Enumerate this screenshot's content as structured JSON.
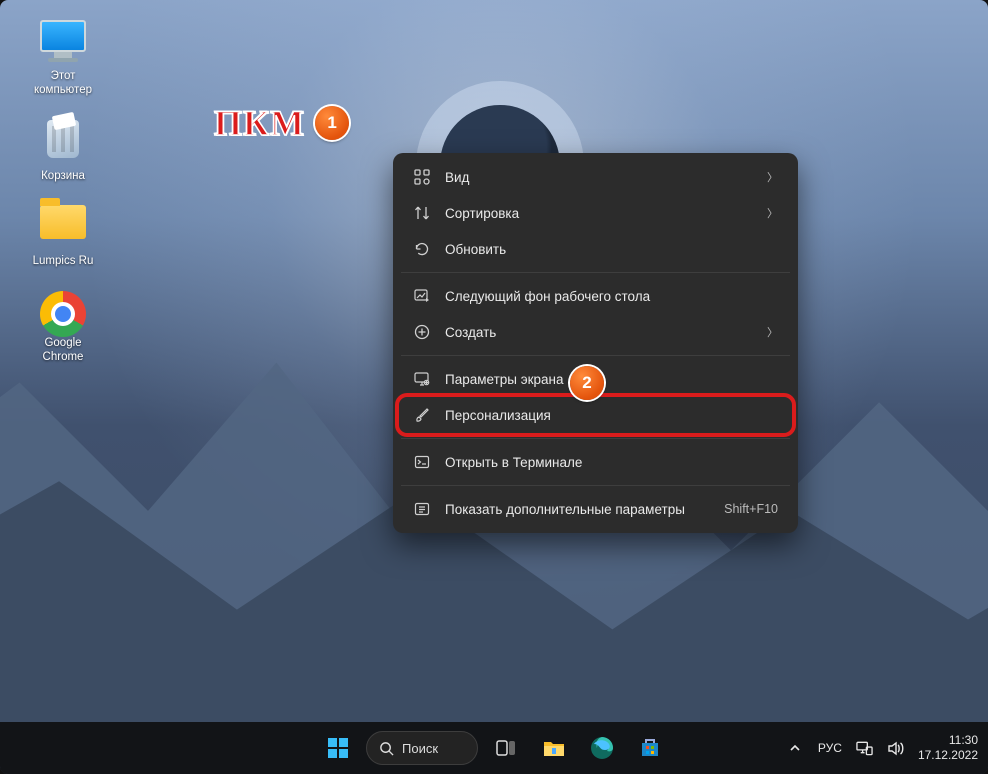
{
  "annotation": {
    "label": "ПКМ",
    "marker1": "1",
    "marker2": "2"
  },
  "desktop_icons": [
    {
      "id": "this-pc",
      "label": "Этот\nкомпьютер"
    },
    {
      "id": "recycle-bin",
      "label": "Корзина"
    },
    {
      "id": "folder",
      "label": "Lumpics Ru"
    },
    {
      "id": "chrome",
      "label": "Google\nChrome"
    }
  ],
  "context_menu": {
    "groups": [
      [
        {
          "id": "view",
          "label": "Вид",
          "submenu": true
        },
        {
          "id": "sort",
          "label": "Сортировка",
          "submenu": true
        },
        {
          "id": "refresh",
          "label": "Обновить"
        }
      ],
      [
        {
          "id": "next-bg",
          "label": "Следующий фон рабочего стола"
        },
        {
          "id": "new",
          "label": "Создать",
          "submenu": true
        }
      ],
      [
        {
          "id": "display-settings",
          "label": "Параметры экрана"
        },
        {
          "id": "personalization",
          "label": "Персонализация",
          "highlighted": true
        }
      ],
      [
        {
          "id": "open-terminal",
          "label": "Открыть в Терминале"
        }
      ],
      [
        {
          "id": "more-options",
          "label": "Показать дополнительные параметры",
          "shortcut": "Shift+F10"
        }
      ]
    ]
  },
  "taskbar": {
    "search_placeholder": "Поиск",
    "items": [
      {
        "id": "start"
      },
      {
        "id": "search"
      },
      {
        "id": "task-view"
      },
      {
        "id": "explorer"
      },
      {
        "id": "edge"
      },
      {
        "id": "store"
      }
    ],
    "tray": {
      "language": "РУС",
      "time": "11:30",
      "date": "17.12.2022"
    }
  }
}
